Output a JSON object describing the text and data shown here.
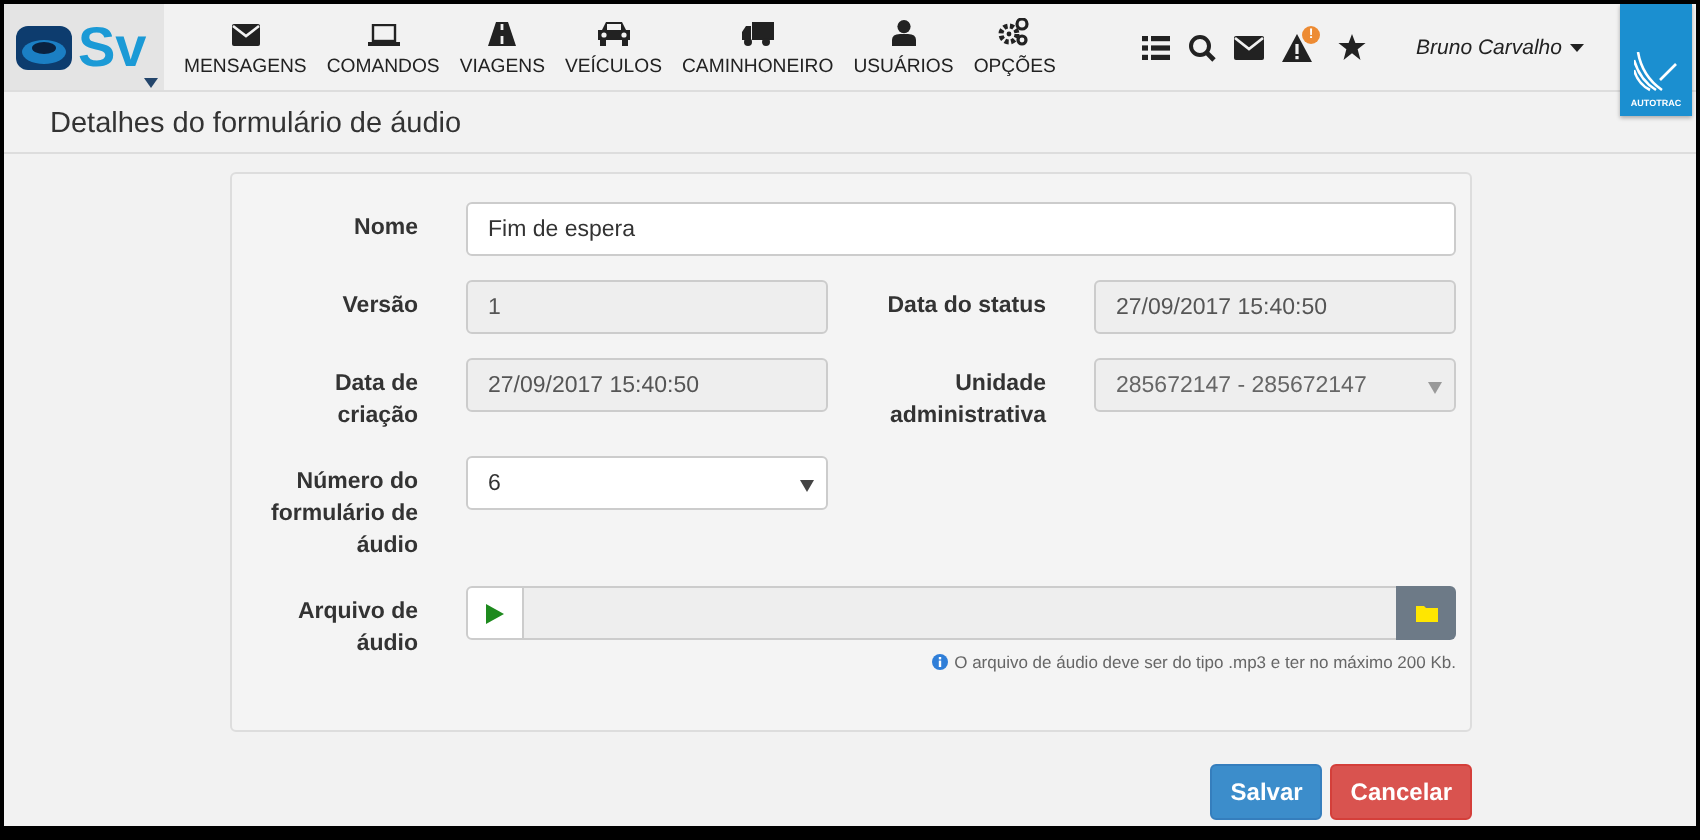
{
  "nav": {
    "logo": "Sv",
    "items": [
      {
        "label": "MENSAGENS"
      },
      {
        "label": "COMANDOS"
      },
      {
        "label": "VIAGENS"
      },
      {
        "label": "VEÍCULOS"
      },
      {
        "label": "CAMINHONEIRO"
      },
      {
        "label": "USUÁRIOS"
      },
      {
        "label": "OPÇÕES"
      }
    ],
    "alert_badge": "!",
    "user": "Bruno Carvalho",
    "brand": "AUTOTRAC"
  },
  "page": {
    "title": "Detalhes do formulário de áudio"
  },
  "form": {
    "rows": [
      [
        {
          "label": "Nome",
          "kind": "text",
          "value": "Fim de espera",
          "disabled": false
        }
      ],
      [
        {
          "label": "Versão",
          "kind": "text",
          "value": "1",
          "disabled": true
        },
        {
          "label": "Data do status",
          "kind": "text",
          "value": "27/09/2017 15:40:50",
          "disabled": true
        }
      ],
      [
        {
          "label": "Data de criação",
          "kind": "text",
          "value": "27/09/2017 15:40:50",
          "disabled": true
        },
        {
          "label": "Unidade administrativa",
          "kind": "select",
          "value": "285672147 - 285672147",
          "disabled": true
        }
      ],
      [
        {
          "label": "Número do formulário de áudio",
          "kind": "select",
          "value": "6",
          "disabled": false
        }
      ],
      [
        {
          "label": "Arquivo de áudio",
          "kind": "file",
          "help": "O arquivo de áudio deve ser do tipo .mp3 e ter no máximo 200 Kb.",
          "disabled": false
        }
      ]
    ]
  },
  "actions": [
    {
      "label": "Salvar",
      "kind": "primary"
    },
    {
      "label": "Cancelar",
      "kind": "danger"
    }
  ]
}
